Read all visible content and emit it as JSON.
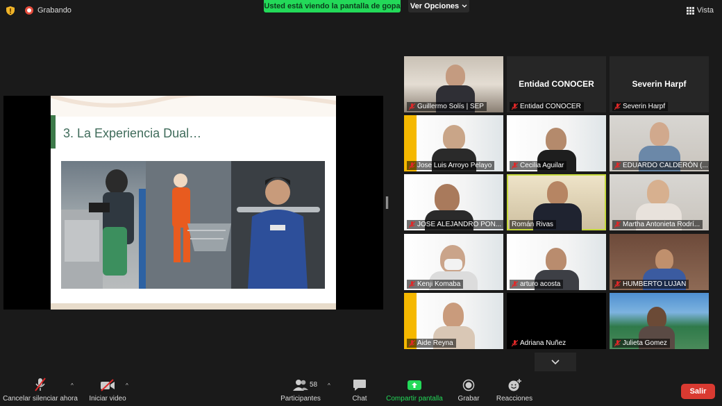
{
  "topbar": {
    "recording_label": "Grabando",
    "share_banner": "Usted está viendo la pantalla de gopa",
    "view_options": "Ver Opciones",
    "view_label": "Vista"
  },
  "slide": {
    "title": "3. La Experiencia Dual…"
  },
  "participants": [
    {
      "name": "Guillermo Solís | SEP",
      "muted": true
    },
    {
      "name": "Entidad CONOCER",
      "center_label": "Entidad CONOCER",
      "muted": true
    },
    {
      "name": "Severin Harpf",
      "center_label": "Severin Harpf",
      "muted": true
    },
    {
      "name": "Jose Luis Arroyo Pelayo",
      "muted": true
    },
    {
      "name": "Cecilia Aguilar",
      "muted": true
    },
    {
      "name": "EDUARDO CALDERÓN (...",
      "muted": true
    },
    {
      "name": "JOSE ALEJANDRO PON...",
      "muted": true
    },
    {
      "name": "Román Rivas",
      "muted": false,
      "speaking": true
    },
    {
      "name": "Martha Antonieta Rodrí...",
      "muted": true
    },
    {
      "name": "Kenji Komaba",
      "muted": true
    },
    {
      "name": "arturo acosta",
      "muted": true
    },
    {
      "name": "HUMBERTO LUJAN",
      "muted": true
    },
    {
      "name": "Aide Reyna",
      "muted": true
    },
    {
      "name": "Adriana Nuñez",
      "muted": true
    },
    {
      "name": "Julieta Gomez",
      "muted": true
    }
  ],
  "toolbar": {
    "mute_label": "Cancelar silenciar ahora",
    "video_label": "Iniciar video",
    "participants_label": "Participantes",
    "participants_count": "58",
    "chat_label": "Chat",
    "share_label": "Compartir pantalla",
    "record_label": "Grabar",
    "reactions_label": "Reacciones",
    "leave_label": "Salir"
  },
  "colors": {
    "banner_green": "#23d959",
    "leave_red": "#d93a31",
    "speaking_outline": "#c4d83a",
    "muted_red": "#e02828"
  }
}
